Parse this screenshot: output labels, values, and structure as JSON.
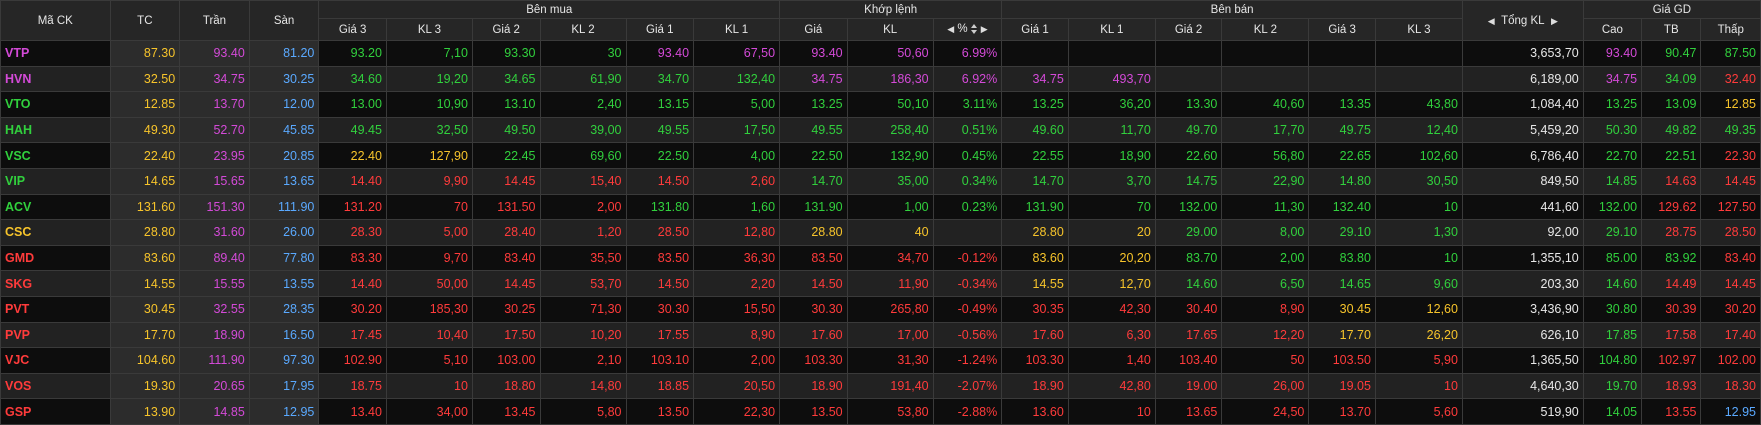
{
  "colors": {
    "ref": "#f7c42b",
    "up": "#31d03d",
    "down": "#ff3b3b",
    "ceil": "#d44ad8",
    "floor": "#5aa9ff",
    "neutral": "#e8e8e8"
  },
  "header": {
    "symbol": "Mã CK",
    "tc": "TC",
    "ceil": "Trần",
    "floor": "Sàn",
    "buy": "Bên mua",
    "match": "Khớp lệnh",
    "sell": "Bên bán",
    "total": "Tổng KL",
    "range": "Giá GD",
    "buy_cols": [
      "Giá 3",
      "KL 3",
      "Giá 2",
      "KL 2",
      "Giá 1",
      "KL 1"
    ],
    "match_price": "Giá",
    "match_vol": "KL",
    "match_pct": "%",
    "sell_cols": [
      "Giá 1",
      "KL 1",
      "Giá 2",
      "KL 2",
      "Giá 3",
      "KL 3"
    ],
    "high": "Cao",
    "avg": "TB",
    "low": "Thấp"
  },
  "rows": [
    {
      "sym": "VTP",
      "tc": "87.30",
      "ceil": "93.40",
      "floor": "81.20",
      "buy": [
        [
          "93.20",
          "up"
        ],
        [
          "7,10",
          "up"
        ],
        [
          "93.30",
          "up"
        ],
        [
          "30",
          "up"
        ],
        [
          "93.40",
          "ceil"
        ],
        [
          "67,50",
          "ceil"
        ]
      ],
      "mp": [
        "93.40",
        "ceil"
      ],
      "mv": "50,60",
      "pct": "6.99%",
      "sell": [
        [
          "",
          ""
        ],
        [
          "",
          ""
        ],
        [
          "",
          ""
        ],
        [
          "",
          ""
        ],
        [
          "",
          ""
        ],
        [
          "",
          ""
        ]
      ],
      "total": "3,653,70",
      "high": [
        "93.40",
        "ceil"
      ],
      "avg": [
        "90.47",
        "up"
      ],
      "low": [
        "87.50",
        "up"
      ],
      "col": "ceil"
    },
    {
      "sym": "HVN",
      "tc": "32.50",
      "ceil": "34.75",
      "floor": "30.25",
      "buy": [
        [
          "34.60",
          "up"
        ],
        [
          "19,20",
          "up"
        ],
        [
          "34.65",
          "up"
        ],
        [
          "61,90",
          "up"
        ],
        [
          "34.70",
          "up"
        ],
        [
          "132,40",
          "up"
        ]
      ],
      "mp": [
        "34.75",
        "ceil"
      ],
      "mv": "186,30",
      "pct": "6.92%",
      "sell": [
        [
          "34.75",
          "ceil"
        ],
        [
          "493,70",
          "ceil"
        ],
        [
          "",
          ""
        ],
        [
          "",
          ""
        ],
        [
          "",
          ""
        ],
        [
          "",
          ""
        ]
      ],
      "total": "6,189,00",
      "high": [
        "34.75",
        "ceil"
      ],
      "avg": [
        "34.09",
        "up"
      ],
      "low": [
        "32.40",
        "down"
      ],
      "col": "ceil"
    },
    {
      "sym": "VTO",
      "tc": "12.85",
      "ceil": "13.70",
      "floor": "12.00",
      "buy": [
        [
          "13.00",
          "up"
        ],
        [
          "10,90",
          "up"
        ],
        [
          "13.10",
          "up"
        ],
        [
          "2,40",
          "up"
        ],
        [
          "13.15",
          "up"
        ],
        [
          "5,00",
          "up"
        ]
      ],
      "mp": [
        "13.25",
        "up"
      ],
      "mv": "50,10",
      "pct": "3.11%",
      "sell": [
        [
          "13.25",
          "up"
        ],
        [
          "36,20",
          "up"
        ],
        [
          "13.30",
          "up"
        ],
        [
          "40,60",
          "up"
        ],
        [
          "13.35",
          "up"
        ],
        [
          "43,80",
          "up"
        ]
      ],
      "total": "1,084,40",
      "high": [
        "13.25",
        "up"
      ],
      "avg": [
        "13.09",
        "up"
      ],
      "low": [
        "12.85",
        "ref"
      ],
      "col": "up"
    },
    {
      "sym": "HAH",
      "tc": "49.30",
      "ceil": "52.70",
      "floor": "45.85",
      "buy": [
        [
          "49.45",
          "up"
        ],
        [
          "32,50",
          "up"
        ],
        [
          "49.50",
          "up"
        ],
        [
          "39,00",
          "up"
        ],
        [
          "49.55",
          "up"
        ],
        [
          "17,50",
          "up"
        ]
      ],
      "mp": [
        "49.55",
        "up"
      ],
      "mv": "258,40",
      "pct": "0.51%",
      "sell": [
        [
          "49.60",
          "up"
        ],
        [
          "11,70",
          "up"
        ],
        [
          "49.70",
          "up"
        ],
        [
          "17,70",
          "up"
        ],
        [
          "49.75",
          "up"
        ],
        [
          "12,40",
          "up"
        ]
      ],
      "total": "5,459,20",
      "high": [
        "50.30",
        "up"
      ],
      "avg": [
        "49.82",
        "up"
      ],
      "low": [
        "49.35",
        "up"
      ],
      "col": "up"
    },
    {
      "sym": "VSC",
      "tc": "22.40",
      "ceil": "23.95",
      "floor": "20.85",
      "buy": [
        [
          "22.40",
          "ref"
        ],
        [
          "127,90",
          "ref"
        ],
        [
          "22.45",
          "up"
        ],
        [
          "69,60",
          "up"
        ],
        [
          "22.50",
          "up"
        ],
        [
          "4,00",
          "up"
        ]
      ],
      "mp": [
        "22.50",
        "up"
      ],
      "mv": "132,90",
      "pct": "0.45%",
      "sell": [
        [
          "22.55",
          "up"
        ],
        [
          "18,90",
          "up"
        ],
        [
          "22.60",
          "up"
        ],
        [
          "56,80",
          "up"
        ],
        [
          "22.65",
          "up"
        ],
        [
          "102,60",
          "up"
        ]
      ],
      "total": "6,786,40",
      "high": [
        "22.70",
        "up"
      ],
      "avg": [
        "22.51",
        "up"
      ],
      "low": [
        "22.30",
        "down"
      ],
      "col": "up"
    },
    {
      "sym": "VIP",
      "tc": "14.65",
      "ceil": "15.65",
      "floor": "13.65",
      "buy": [
        [
          "14.40",
          "down"
        ],
        [
          "9,90",
          "down"
        ],
        [
          "14.45",
          "down"
        ],
        [
          "15,40",
          "down"
        ],
        [
          "14.50",
          "down"
        ],
        [
          "2,60",
          "down"
        ]
      ],
      "mp": [
        "14.70",
        "up"
      ],
      "mv": "35,00",
      "pct": "0.34%",
      "sell": [
        [
          "14.70",
          "up"
        ],
        [
          "3,70",
          "up"
        ],
        [
          "14.75",
          "up"
        ],
        [
          "22,90",
          "up"
        ],
        [
          "14.80",
          "up"
        ],
        [
          "30,50",
          "up"
        ]
      ],
      "total": "849,50",
      "high": [
        "14.85",
        "up"
      ],
      "avg": [
        "14.63",
        "down"
      ],
      "low": [
        "14.45",
        "down"
      ],
      "col": "up"
    },
    {
      "sym": "ACV",
      "tc": "131.60",
      "ceil": "151.30",
      "floor": "111.90",
      "buy": [
        [
          "131.20",
          "down"
        ],
        [
          "70",
          "down"
        ],
        [
          "131.50",
          "down"
        ],
        [
          "2,00",
          "down"
        ],
        [
          "131.80",
          "up"
        ],
        [
          "1,60",
          "up"
        ]
      ],
      "mp": [
        "131.90",
        "up"
      ],
      "mv": "1,00",
      "pct": "0.23%",
      "sell": [
        [
          "131.90",
          "up"
        ],
        [
          "70",
          "up"
        ],
        [
          "132.00",
          "up"
        ],
        [
          "11,30",
          "up"
        ],
        [
          "132.40",
          "up"
        ],
        [
          "10",
          "up"
        ]
      ],
      "total": "441,60",
      "high": [
        "132.00",
        "up"
      ],
      "avg": [
        "129.62",
        "down"
      ],
      "low": [
        "127.50",
        "down"
      ],
      "col": "up"
    },
    {
      "sym": "CSC",
      "tc": "28.80",
      "ceil": "31.60",
      "floor": "26.00",
      "buy": [
        [
          "28.30",
          "down"
        ],
        [
          "5,00",
          "down"
        ],
        [
          "28.40",
          "down"
        ],
        [
          "1,20",
          "down"
        ],
        [
          "28.50",
          "down"
        ],
        [
          "12,80",
          "down"
        ]
      ],
      "mp": [
        "28.80",
        "ref"
      ],
      "mv": "40",
      "pct": "",
      "sell": [
        [
          "28.80",
          "ref"
        ],
        [
          "20",
          "ref"
        ],
        [
          "29.00",
          "up"
        ],
        [
          "8,00",
          "up"
        ],
        [
          "29.10",
          "up"
        ],
        [
          "1,30",
          "up"
        ]
      ],
      "total": "92,00",
      "high": [
        "29.10",
        "up"
      ],
      "avg": [
        "28.75",
        "down"
      ],
      "low": [
        "28.50",
        "down"
      ],
      "col": "ref"
    },
    {
      "sym": "GMD",
      "tc": "83.60",
      "ceil": "89.40",
      "floor": "77.80",
      "buy": [
        [
          "83.30",
          "down"
        ],
        [
          "9,70",
          "down"
        ],
        [
          "83.40",
          "down"
        ],
        [
          "35,50",
          "down"
        ],
        [
          "83.50",
          "down"
        ],
        [
          "36,30",
          "down"
        ]
      ],
      "mp": [
        "83.50",
        "down"
      ],
      "mv": "34,70",
      "pct": "-0.12%",
      "sell": [
        [
          "83.60",
          "ref"
        ],
        [
          "20,20",
          "ref"
        ],
        [
          "83.70",
          "up"
        ],
        [
          "2,00",
          "up"
        ],
        [
          "83.80",
          "up"
        ],
        [
          "10",
          "up"
        ]
      ],
      "total": "1,355,10",
      "high": [
        "85.00",
        "up"
      ],
      "avg": [
        "83.92",
        "up"
      ],
      "low": [
        "83.40",
        "down"
      ],
      "col": "down"
    },
    {
      "sym": "SKG",
      "tc": "14.55",
      "ceil": "15.55",
      "floor": "13.55",
      "buy": [
        [
          "14.40",
          "down"
        ],
        [
          "50,00",
          "down"
        ],
        [
          "14.45",
          "down"
        ],
        [
          "53,70",
          "down"
        ],
        [
          "14.50",
          "down"
        ],
        [
          "2,20",
          "down"
        ]
      ],
      "mp": [
        "14.50",
        "down"
      ],
      "mv": "11,90",
      "pct": "-0.34%",
      "sell": [
        [
          "14.55",
          "ref"
        ],
        [
          "12,70",
          "ref"
        ],
        [
          "14.60",
          "up"
        ],
        [
          "6,50",
          "up"
        ],
        [
          "14.65",
          "up"
        ],
        [
          "9,60",
          "up"
        ]
      ],
      "total": "203,30",
      "high": [
        "14.60",
        "up"
      ],
      "avg": [
        "14.49",
        "down"
      ],
      "low": [
        "14.45",
        "down"
      ],
      "col": "down"
    },
    {
      "sym": "PVT",
      "tc": "30.45",
      "ceil": "32.55",
      "floor": "28.35",
      "buy": [
        [
          "30.20",
          "down"
        ],
        [
          "185,30",
          "down"
        ],
        [
          "30.25",
          "down"
        ],
        [
          "71,30",
          "down"
        ],
        [
          "30.30",
          "down"
        ],
        [
          "15,50",
          "down"
        ]
      ],
      "mp": [
        "30.30",
        "down"
      ],
      "mv": "265,80",
      "pct": "-0.49%",
      "sell": [
        [
          "30.35",
          "down"
        ],
        [
          "42,30",
          "down"
        ],
        [
          "30.40",
          "down"
        ],
        [
          "8,90",
          "down"
        ],
        [
          "30.45",
          "ref"
        ],
        [
          "12,60",
          "ref"
        ]
      ],
      "total": "3,436,90",
      "high": [
        "30.80",
        "up"
      ],
      "avg": [
        "30.39",
        "down"
      ],
      "low": [
        "30.20",
        "down"
      ],
      "col": "down"
    },
    {
      "sym": "PVP",
      "tc": "17.70",
      "ceil": "18.90",
      "floor": "16.50",
      "buy": [
        [
          "17.45",
          "down"
        ],
        [
          "10,40",
          "down"
        ],
        [
          "17.50",
          "down"
        ],
        [
          "10,20",
          "down"
        ],
        [
          "17.55",
          "down"
        ],
        [
          "8,90",
          "down"
        ]
      ],
      "mp": [
        "17.60",
        "down"
      ],
      "mv": "17,00",
      "pct": "-0.56%",
      "sell": [
        [
          "17.60",
          "down"
        ],
        [
          "6,30",
          "down"
        ],
        [
          "17.65",
          "down"
        ],
        [
          "12,20",
          "down"
        ],
        [
          "17.70",
          "ref"
        ],
        [
          "26,20",
          "ref"
        ]
      ],
      "total": "626,10",
      "high": [
        "17.85",
        "up"
      ],
      "avg": [
        "17.58",
        "down"
      ],
      "low": [
        "17.40",
        "down"
      ],
      "col": "down"
    },
    {
      "sym": "VJC",
      "tc": "104.60",
      "ceil": "111.90",
      "floor": "97.30",
      "buy": [
        [
          "102.90",
          "down"
        ],
        [
          "5,10",
          "down"
        ],
        [
          "103.00",
          "down"
        ],
        [
          "2,10",
          "down"
        ],
        [
          "103.10",
          "down"
        ],
        [
          "2,00",
          "down"
        ]
      ],
      "mp": [
        "103.30",
        "down"
      ],
      "mv": "31,30",
      "pct": "-1.24%",
      "sell": [
        [
          "103.30",
          "down"
        ],
        [
          "1,40",
          "down"
        ],
        [
          "103.40",
          "down"
        ],
        [
          "50",
          "down"
        ],
        [
          "103.50",
          "down"
        ],
        [
          "5,90",
          "down"
        ]
      ],
      "total": "1,365,50",
      "high": [
        "104.80",
        "up"
      ],
      "avg": [
        "102.97",
        "down"
      ],
      "low": [
        "102.00",
        "down"
      ],
      "col": "down"
    },
    {
      "sym": "VOS",
      "tc": "19.30",
      "ceil": "20.65",
      "floor": "17.95",
      "buy": [
        [
          "18.75",
          "down"
        ],
        [
          "10",
          "down"
        ],
        [
          "18.80",
          "down"
        ],
        [
          "14,80",
          "down"
        ],
        [
          "18.85",
          "down"
        ],
        [
          "20,50",
          "down"
        ]
      ],
      "mp": [
        "18.90",
        "down"
      ],
      "mv": "191,40",
      "pct": "-2.07%",
      "sell": [
        [
          "18.90",
          "down"
        ],
        [
          "42,80",
          "down"
        ],
        [
          "19.00",
          "down"
        ],
        [
          "26,00",
          "down"
        ],
        [
          "19.05",
          "down"
        ],
        [
          "10",
          "down"
        ]
      ],
      "total": "4,640,30",
      "high": [
        "19.70",
        "up"
      ],
      "avg": [
        "18.93",
        "down"
      ],
      "low": [
        "18.30",
        "down"
      ],
      "col": "down"
    },
    {
      "sym": "GSP",
      "tc": "13.90",
      "ceil": "14.85",
      "floor": "12.95",
      "buy": [
        [
          "13.40",
          "down"
        ],
        [
          "34,00",
          "down"
        ],
        [
          "13.45",
          "down"
        ],
        [
          "5,80",
          "down"
        ],
        [
          "13.50",
          "down"
        ],
        [
          "22,30",
          "down"
        ]
      ],
      "mp": [
        "13.50",
        "down"
      ],
      "mv": "53,80",
      "pct": "-2.88%",
      "sell": [
        [
          "13.60",
          "down"
        ],
        [
          "10",
          "down"
        ],
        [
          "13.65",
          "down"
        ],
        [
          "24,50",
          "down"
        ],
        [
          "13.70",
          "down"
        ],
        [
          "5,60",
          "down"
        ]
      ],
      "total": "519,90",
      "high": [
        "14.05",
        "up"
      ],
      "avg": [
        "13.55",
        "down"
      ],
      "low": [
        "12.95",
        "floor"
      ],
      "col": "down"
    }
  ]
}
